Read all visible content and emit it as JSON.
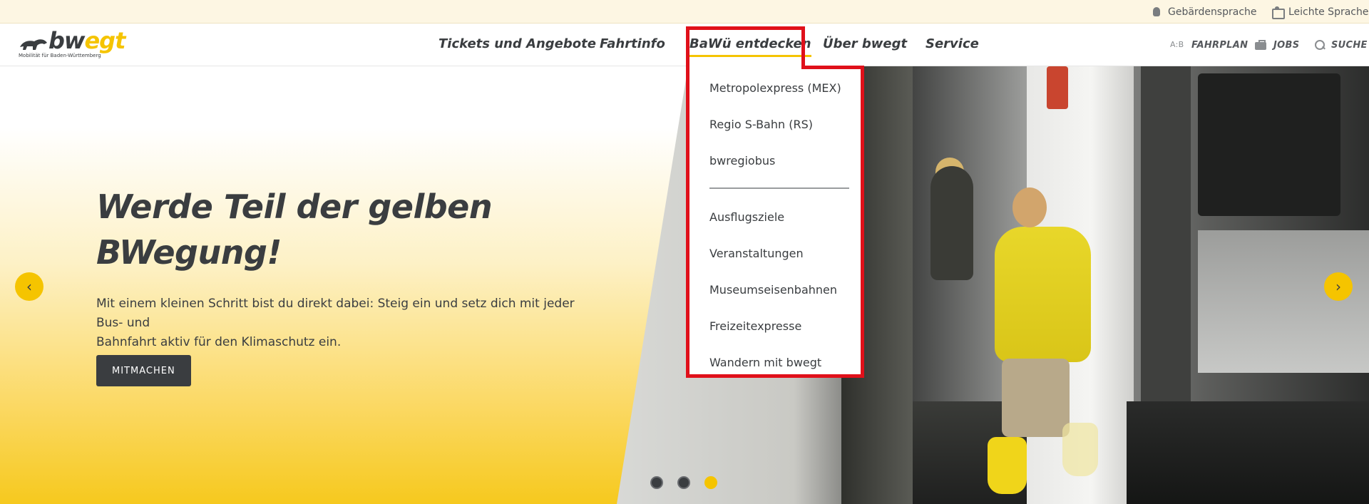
{
  "utility_bar": {
    "sign_language": "Gebärdensprache",
    "easy_language": "Leichte Sprache"
  },
  "logo": {
    "word_a": "bw",
    "word_b": "egt",
    "tagline": "Mobilität für Baden-Württemberg"
  },
  "nav": {
    "items": [
      {
        "label": "Tickets und Angebote"
      },
      {
        "label": "Fahrtinfo"
      },
      {
        "label": "BaWü entdecken"
      },
      {
        "label": "Über bwegt"
      },
      {
        "label": "Service"
      }
    ]
  },
  "tools": {
    "fahrplan_icon": "A:B",
    "fahrplan": "FAHRPLAN",
    "jobs": "JOBS",
    "suche": "SUCHE"
  },
  "dropdown": {
    "group1": [
      "Metropolexpress (MEX)",
      "Regio S-Bahn (RS)",
      "bwregiobus"
    ],
    "group2": [
      "Ausflugsziele",
      "Veranstaltungen",
      "Museumseisenbahnen",
      "Freizeitexpresse",
      "Wandern mit bwegt"
    ]
  },
  "hero": {
    "title_line1": "Werde Teil der gelben",
    "title_line2": "BWegung!",
    "text_line1": "Mit einem kleinen Schritt bist du direkt dabei: Steig ein und setz dich mit jeder Bus- und",
    "text_line2": "Bahnfahrt aktiv für den Klimaschutz ein.",
    "cta": "MITMACHEN",
    "prev_glyph": "‹",
    "next_glyph": "›"
  },
  "colors": {
    "brand_yellow": "#f5c400",
    "text_dark": "#3a3d40",
    "highlight_red": "#e0101a"
  }
}
